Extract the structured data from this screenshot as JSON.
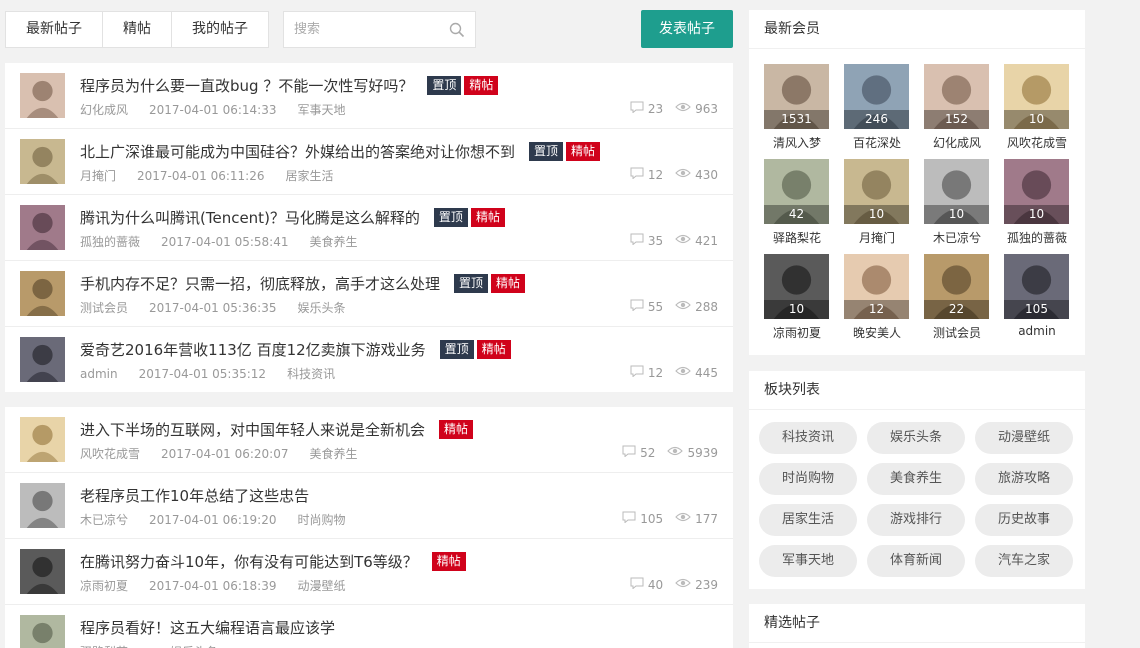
{
  "colors": {
    "accent": "#1e9e8e",
    "badge_top": "#2e3a4d",
    "badge_elite": "#d0021b",
    "text_muted": "#999999"
  },
  "toolbar": {
    "tabs": [
      "最新帖子",
      "精帖",
      "我的帖子"
    ],
    "search_placeholder": "搜索",
    "post_button": "发表帖子"
  },
  "top_posts": [
    {
      "title": "程序员为什么要一直改bug ？不能一次性写好吗？",
      "badges": [
        "置顶",
        "精帖"
      ],
      "author": "幻化成风",
      "time": "2017-04-01 06:14:33",
      "category": "军事天地",
      "comments": "23",
      "views": "963"
    },
    {
      "title": "北上广深谁最可能成为中国硅谷？外媒给出的答案绝对让你想不到",
      "badges": [
        "置顶",
        "精帖"
      ],
      "author": "月掩门",
      "time": "2017-04-01 06:11:26",
      "category": "居家生活",
      "comments": "12",
      "views": "430"
    },
    {
      "title": "腾讯为什么叫腾讯(Tencent)？马化腾是这么解释的",
      "badges": [
        "置顶",
        "精帖"
      ],
      "author": "孤独的蔷薇",
      "time": "2017-04-01 05:58:41",
      "category": "美食养生",
      "comments": "35",
      "views": "421"
    },
    {
      "title": "手机内存不足？只需一招，彻底释放，高手才这么处理",
      "badges": [
        "置顶",
        "精帖"
      ],
      "author": "测试会员",
      "time": "2017-04-01 05:36:35",
      "category": "娱乐头条",
      "comments": "55",
      "views": "288"
    },
    {
      "title": "爱奇艺2016年营收113亿 百度12亿卖旗下游戏业务",
      "badges": [
        "置顶",
        "精帖"
      ],
      "author": "admin",
      "time": "2017-04-01 05:35:12",
      "category": "科技资讯",
      "comments": "12",
      "views": "445"
    }
  ],
  "posts": [
    {
      "title": "进入下半场的互联网，对中国年轻人来说是全新机会",
      "badges": [
        "精帖"
      ],
      "author": "风吹花成雪",
      "time": "2017-04-01 06:20:07",
      "category": "美食养生",
      "comments": "52",
      "views": "5939"
    },
    {
      "title": "老程序员工作10年总结了这些忠告",
      "badges": [],
      "author": "木已凉兮",
      "time": "2017-04-01 06:19:20",
      "category": "时尚购物",
      "comments": "105",
      "views": "177"
    },
    {
      "title": "在腾讯努力奋斗10年，你有没有可能达到T6等级？",
      "badges": [
        "精帖"
      ],
      "author": "凉雨初夏",
      "time": "2017-04-01 06:18:39",
      "category": "动漫壁纸",
      "comments": "40",
      "views": "239"
    },
    {
      "title": "程序员看好！这五大编程语言最应该学",
      "badges": [],
      "author": "驿路梨花",
      "time": "",
      "category": "娱乐头条",
      "comments": "",
      "views": ""
    }
  ],
  "sidebar": {
    "members_title": "最新会员",
    "members": [
      {
        "name": "清风入梦",
        "count": "1531"
      },
      {
        "name": "百花深处",
        "count": "246"
      },
      {
        "name": "幻化成风",
        "count": "152"
      },
      {
        "name": "风吹花成雪",
        "count": "10"
      },
      {
        "name": "驿路梨花",
        "count": "42"
      },
      {
        "name": "月掩门",
        "count": "10"
      },
      {
        "name": "木已凉兮",
        "count": "10"
      },
      {
        "name": "孤独的蔷薇",
        "count": "10"
      },
      {
        "name": "凉雨初夏",
        "count": "10"
      },
      {
        "name": "晚安美人",
        "count": "12"
      },
      {
        "name": "测试会员",
        "count": "22"
      },
      {
        "name": "admin",
        "count": "105"
      }
    ],
    "boards_title": "板块列表",
    "boards": [
      "科技资讯",
      "娱乐头条",
      "动漫壁纸",
      "时尚购物",
      "美食养生",
      "旅游攻略",
      "居家生活",
      "游戏排行",
      "历史故事",
      "军事天地",
      "体育新闻",
      "汽车之家"
    ],
    "picks_title": "精选帖子"
  }
}
